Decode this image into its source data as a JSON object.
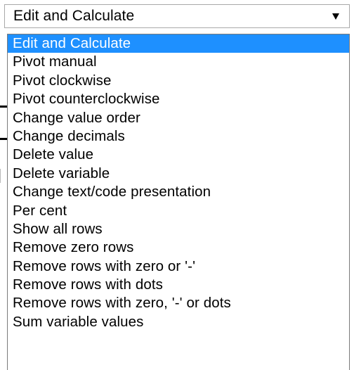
{
  "select": {
    "value": "Edit and Calculate",
    "arrow_icon": "triangle-down-icon"
  },
  "dropdown": {
    "selected_index": 0,
    "options": [
      "Edit and Calculate",
      "Pivot manual",
      "Pivot clockwise",
      "Pivot counterclockwise",
      "Change value order",
      "Change decimals",
      "Delete value",
      "Delete variable",
      "Change text/code presentation",
      "Per cent",
      "Show all rows",
      "Remove zero rows",
      "Remove rows with zero or '-'",
      "Remove rows with dots",
      "Remove rows with zero, '-' or dots",
      "Sum variable values"
    ]
  },
  "colors": {
    "highlight": "#1e90ff",
    "border": "#a9a9a9"
  }
}
